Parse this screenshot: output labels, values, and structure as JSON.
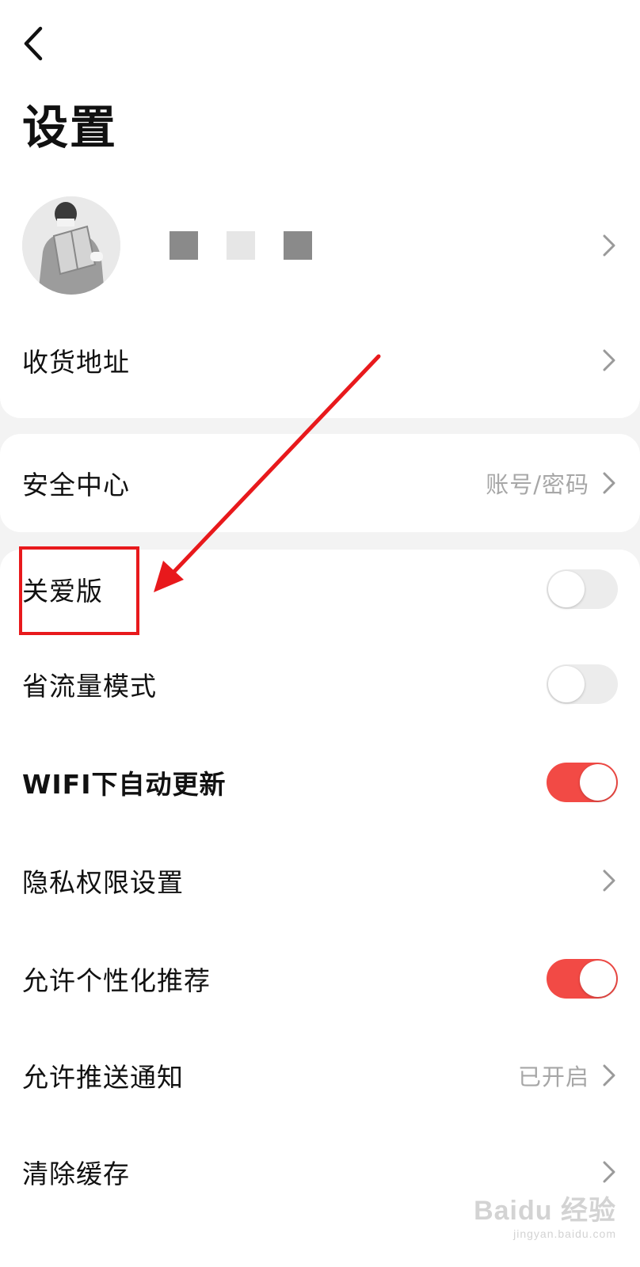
{
  "header": {
    "title": "设置"
  },
  "profile": {
    "name_blocks": [
      "#8a8a8a",
      "#e6e6e6",
      "#8a8a8a"
    ]
  },
  "menu": {
    "address": "收货地址",
    "security": {
      "label": "安全中心",
      "value": "账号/密码"
    },
    "care_mode": {
      "label": "关爱版",
      "toggle": "off"
    },
    "data_saver": {
      "label": "省流量模式",
      "toggle": "off"
    },
    "wifi_update": {
      "label": "WIFI下自动更新",
      "toggle": "on"
    },
    "privacy": {
      "label": "隐私权限设置"
    },
    "personalized": {
      "label": "允许个性化推荐",
      "toggle": "on"
    },
    "push": {
      "label": "允许推送通知",
      "value": "已开启"
    },
    "cache": {
      "label": "清除缓存"
    }
  },
  "colors": {
    "accent": "#f24a45",
    "annotation": "#e8191c"
  },
  "watermark": {
    "main": "Baidu 经验",
    "sub": "jingyan.baidu.com"
  }
}
